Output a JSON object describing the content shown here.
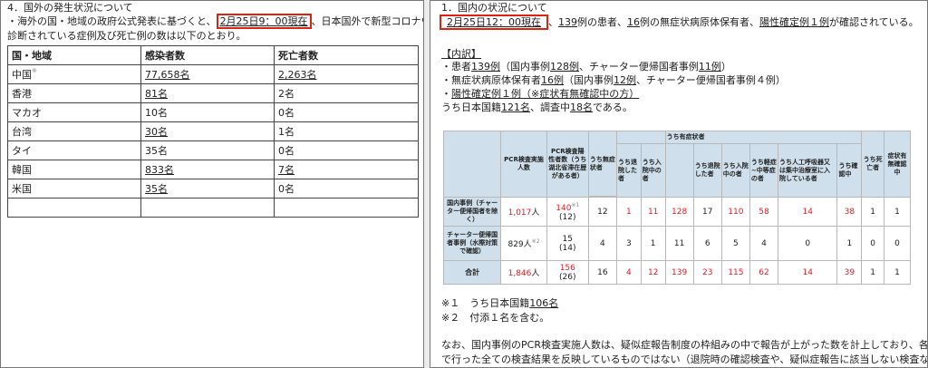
{
  "left": {
    "heading": "4．国外の発生状況について",
    "para1_pre": "・海外の国・地域の政府公式発表に基づくと、",
    "para1_date": "2月25日9：00現在",
    "para1_post": "、日本国外で新型コロナウイル",
    "para2": "診断されている症例及び死亡例の数は以下のとおり。",
    "table": {
      "headers": [
        "国・地域",
        "感染者数",
        "死亡者数"
      ],
      "rows": [
        {
          "region": "中国",
          "mark": "※",
          "cases": "77,658名",
          "deaths": "2,263名"
        },
        {
          "region": "香港",
          "mark": "",
          "cases": "81名",
          "deaths": "2名"
        },
        {
          "region": "マカオ",
          "mark": "",
          "cases": "10名",
          "deaths": "0名"
        },
        {
          "region": "台湾",
          "mark": "",
          "cases": "30名",
          "deaths": "1名"
        },
        {
          "region": "タイ",
          "mark": "",
          "cases": "35名",
          "deaths": "0名"
        },
        {
          "region": "韓国",
          "mark": "",
          "cases": "833名",
          "deaths": "7名"
        },
        {
          "region": "米国",
          "mark": "",
          "cases": "35名",
          "deaths": "0名"
        }
      ]
    }
  },
  "right": {
    "heading": "1．国内の状況について",
    "l1_date": "2月25日12：00現在",
    "l1_sep": "、",
    "l1_patients": "139",
    "l1_t1": "例の患者、",
    "l1_carriers": "16",
    "l1_t2": "例の無症状病原体保有者、",
    "l1_positive": "陽性確定例１例",
    "l1_t3": "が確認されている。",
    "breakdown_title": "【内訳】",
    "b1_pre": "・患者",
    "b1_num": "139例",
    "b1_mid": "（国内事例",
    "b1_dom": "128例",
    "b1_mid2": "、チャーター便帰国者事例",
    "b1_ch": "11例",
    "b1_end": "）",
    "b2_pre": "・無症状病原体保有者",
    "b2_num": "16例",
    "b2_mid": "（国内事例",
    "b2_dom": "12例",
    "b2_end": "、チャーター便帰国者事例４例）",
    "b3_pre": "・",
    "b3_link": "陽性確定例１例（※症状有無確認中の方）",
    "b4_pre": "うち日本国籍",
    "b4_num": "121名",
    "b4_mid": "、調査中",
    "b4_inv": "18名",
    "b4_end": "である。",
    "table": {
      "h_pcr": "PCR検査実施人数",
      "h_pos": "PCR検査陽性者数（うち湖北省滞在歴がある者）",
      "h_asym": "うち無症状者",
      "h_asym_disc": "うち退院した者",
      "h_asym_hosp": "うち入院中の者",
      "h_sym": "うち有症状者",
      "h_sym_all": "",
      "h_sym_disc": "うち退院した者",
      "h_sym_hosp": "うち入院中の者",
      "h_sym_mild": "うち軽症~中等症の者",
      "h_sym_vent": "うち人工呼吸器又は集中治療室に入院している者",
      "h_sym_conf": "うち確認中",
      "h_death": "うち死亡者",
      "h_unk": "症状有無確認中",
      "rows": [
        {
          "label": "国内事例（チャーター便帰国者を除く）",
          "pcr": "1,017",
          "pcr_unit": "人",
          "pcr_note": "",
          "pos": "140",
          "pos_note": "※1",
          "pos_sub": "(12)",
          "asym": "12",
          "asym_disc": "1",
          "asym_hosp": "11",
          "sym": "128",
          "sym_disc": "17",
          "sym_hosp": "110",
          "mild": "58",
          "vent": "14",
          "conf": "38",
          "death": "1",
          "unk": "1"
        },
        {
          "label": "チャーター便帰国者事例（水際対策で確認）",
          "pcr": "829",
          "pcr_unit": "人",
          "pcr_note": "※2",
          "pos": "15",
          "pos_note": "",
          "pos_sub": "(14)",
          "asym": "4",
          "asym_disc": "3",
          "asym_hosp": "1",
          "sym": "11",
          "sym_disc": "6",
          "sym_hosp": "5",
          "mild": "4",
          "vent": "0",
          "conf": "1",
          "death": "0",
          "unk": "0"
        },
        {
          "label": "合計",
          "pcr": "1,846",
          "pcr_unit": "人",
          "pcr_note": "",
          "pos": "156",
          "pos_note": "",
          "pos_sub": "(26)",
          "asym": "16",
          "asym_disc": "4",
          "asym_hosp": "12",
          "sym": "139",
          "sym_disc": "23",
          "sym_hosp": "115",
          "mild": "62",
          "vent": "14",
          "conf": "39",
          "death": "1",
          "unk": "1"
        }
      ]
    },
    "note1_pre": "※１　うち日本国籍",
    "note1_num": "106名",
    "note2": "※２　付添１名を含む。",
    "para_a": "なお、国内事例のPCR検査実施人数は、疑似症報告制度の枠組みの中で報告が上がった数を計上しており、各自治体",
    "para_b": "で行った全ての検査結果を反映しているものではない（退院時の確認検査や、疑似症報告に該当しない検査などは含"
  },
  "colors": {
    "highlight_box": "#d21111",
    "red_text": "#e31b23",
    "table_header": "#cfe0ec"
  }
}
